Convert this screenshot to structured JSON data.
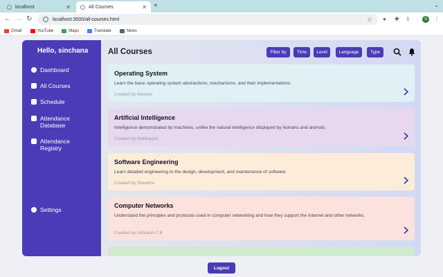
{
  "browser": {
    "tabs": [
      {
        "title": "localhost"
      },
      {
        "title": "All Courses"
      }
    ],
    "url": "localhost:3000/all-courses.html",
    "bookmarks": [
      {
        "label": "Gmail",
        "color": "#ea4335"
      },
      {
        "label": "YouTube",
        "color": "#ff0000"
      },
      {
        "label": "Maps",
        "color": "#34a853"
      },
      {
        "label": "Translate",
        "color": "#4285f4"
      },
      {
        "label": "News",
        "color": "#5f6368"
      }
    ],
    "profile_initial": "S"
  },
  "sidebar": {
    "greeting": "Hello, sinchana",
    "items": [
      {
        "label": "Dashboard",
        "icon": "dashboard-icon"
      },
      {
        "label": "All Courses",
        "icon": "book-icon"
      },
      {
        "label": "Schedule",
        "icon": "calendar-icon"
      },
      {
        "label": "Attendance Database",
        "icon": "database-icon"
      },
      {
        "label": "Attendance Registry",
        "icon": "clipboard-icon"
      },
      {
        "label": "Settings",
        "icon": "gear-icon"
      }
    ]
  },
  "main": {
    "title": "All Courses",
    "filters": [
      "Filter by",
      "Time",
      "Level",
      "Language",
      "Type"
    ],
    "courses": [
      {
        "title": "Operating System",
        "description": "Learn the basic operating system abstractions, mechanisms, and their implementations.",
        "created_by": "Created by Naveen",
        "color": "#e0f1f6"
      },
      {
        "title": "Artificial Intelligence",
        "description": "Intelligence demonstrated by machines, unlike the natural intelligence displayed by humans and animals.",
        "created_by": "Created by Mallikarjun",
        "color": "#e7d8f0"
      },
      {
        "title": "Software Engineering",
        "description": "Learn detailed engineering to the design, development, and maintenance of software.",
        "created_by": "Created by Shwetha",
        "color": "#fdecd9"
      },
      {
        "title": "Computer Networks",
        "description": "Understand the principles and protocols used in computer networking and how they support the Internet and other networks.",
        "created_by": "Created by Abhilash C B",
        "color": "#fbe2dd"
      }
    ]
  },
  "logout_label": "Logout",
  "colors": {
    "accent": "#4a3cb6"
  }
}
